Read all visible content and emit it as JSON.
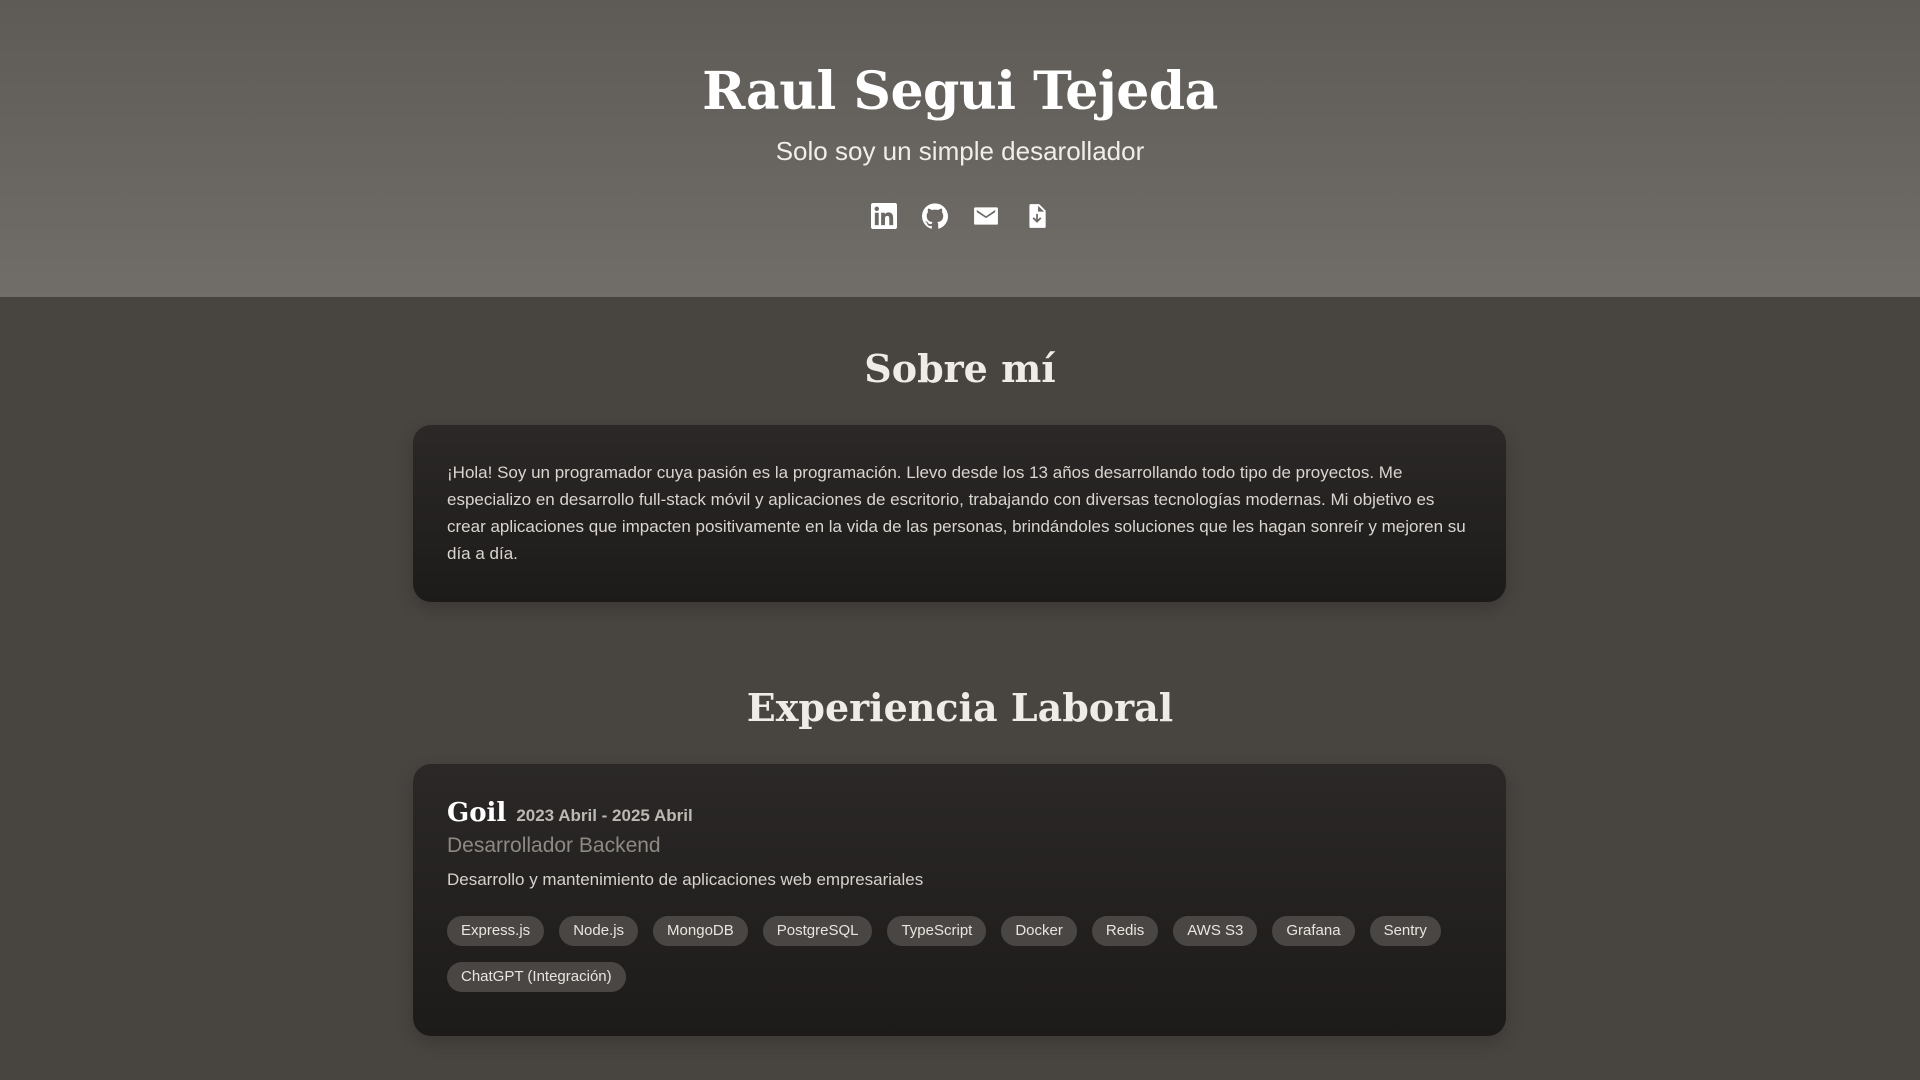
{
  "header": {
    "name": "Raul Segui Tejeda",
    "subtitle": "Solo soy un simple desarollador",
    "socials": [
      {
        "icon": "linkedin-icon"
      },
      {
        "icon": "github-icon"
      },
      {
        "icon": "mail-icon"
      },
      {
        "icon": "document-download-icon"
      }
    ]
  },
  "about": {
    "title": "Sobre mí",
    "text": "¡Hola! Soy un programador cuya pasión es la programación. Llevo desde los 13 años desarrollando todo tipo de proyectos. Me especializo en desarrollo full-stack móvil y aplicaciones de escritorio, trabajando con diversas tecnologías modernas. Mi objetivo es crear aplicaciones que impacten positivamente en la vida de las personas, brindándoles soluciones que les hagan sonreír y mejoren su día a día."
  },
  "experience": {
    "title": "Experiencia Laboral",
    "jobs": [
      {
        "company": "Goil",
        "period": "2023 Abril - 2025 Abril",
        "role": "Desarrollador Backend",
        "description": "Desarrollo y mantenimiento de aplicaciones web empresariales",
        "tags": [
          "Express.js",
          "Node.js",
          "MongoDB",
          "PostgreSQL",
          "TypeScript",
          "Docker",
          "Redis",
          "AWS S3",
          "Grafana",
          "Sentry",
          "ChatGPT (Integración)"
        ]
      }
    ]
  },
  "colors": {
    "page_background": "#484440",
    "header_gradient_top": "#5e5a55",
    "header_gradient_bottom": "#716d69",
    "card_background": "#231f1e",
    "tag_background": "#4a4643"
  }
}
